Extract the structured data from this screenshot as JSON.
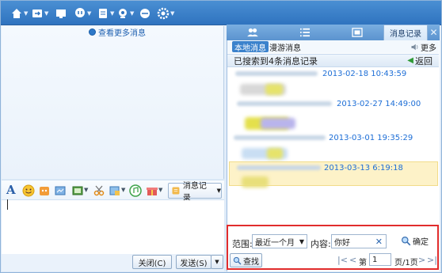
{
  "toolbar": {
    "icons": [
      "home-icon",
      "transfer-icon",
      "screen-icon",
      "voice-icon",
      "file-icon",
      "camera-icon",
      "app-icon",
      "settings-icon"
    ]
  },
  "left": {
    "more_messages": "查看更多消息",
    "history_button": "消息记录",
    "close_button": "关闭(C)",
    "send_button": "发送(S)"
  },
  "right": {
    "tabs": [
      "",
      "",
      "",
      "消息记录"
    ],
    "subtabs": [
      "本地消息",
      "漫游消息"
    ],
    "more": "更多",
    "search_status": "已搜索到4条消息记录",
    "back": "返回",
    "records": [
      {
        "time": "2013-02-18 10:43:59"
      },
      {
        "time": "2013-02-27 14:49:00"
      },
      {
        "time": "2013-03-01 19:35:29"
      },
      {
        "time": "2013-03-13 6:19:18"
      }
    ],
    "search": {
      "range_label": "范围:",
      "range_value": "最近一个月",
      "content_label": "内容:",
      "content_value": "你好",
      "confirm": "确定",
      "find": "查找",
      "page_prefix": "第",
      "page_value": "1",
      "page_suffix": "页/1页"
    }
  },
  "colors": {
    "toolbar": "#3a80c8",
    "link": "#1d6ed6",
    "highlight": "#fdf2c8",
    "search_border": "#e12c2c"
  }
}
